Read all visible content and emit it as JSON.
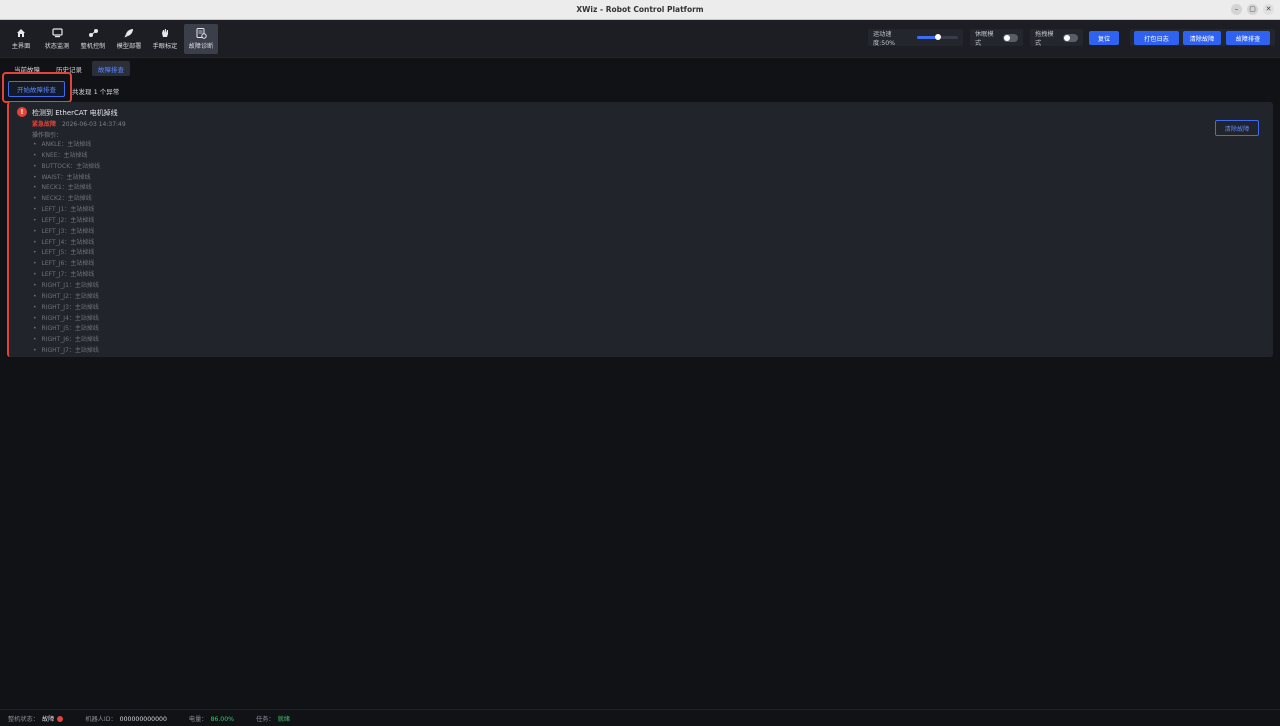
{
  "window": {
    "title": "XWiz - Robot Control Platform"
  },
  "nav": [
    {
      "label": "主界面",
      "icon": "home-icon"
    },
    {
      "label": "状态监测",
      "icon": "monitor-icon"
    },
    {
      "label": "整机控制",
      "icon": "control-icon"
    },
    {
      "label": "模型部署",
      "icon": "rocket-icon"
    },
    {
      "label": "手眼标定",
      "icon": "hand-icon"
    },
    {
      "label": "故障诊断",
      "icon": "diagnosis-icon",
      "active": true
    }
  ],
  "controls": {
    "speed_label": "运动速度:50%",
    "speed_value": 50,
    "rest_mode_label": "休眠模式",
    "drag_mode_label": "拖拽模式",
    "reset_label": "复位",
    "print_log_label": "打包日志",
    "clear_fault_label": "清除故障",
    "fault_check_label": "故障排查"
  },
  "tabs": [
    {
      "label": "当前故障"
    },
    {
      "label": "历史记录"
    },
    {
      "label": "故障排查",
      "active": true
    }
  ],
  "diagnosis": {
    "start_button": "开始故障排查",
    "found_text": "共发现 1 个异常"
  },
  "fault": {
    "icon_text": "!",
    "title": "检测到 EtherCAT 电机掉线",
    "severity": "紧急故障",
    "timestamp": "2026-06-03 14:37:49",
    "guide_label": "操作指引：",
    "items": [
      "ANKLE：主站掉线",
      "KNEE：主站掉线",
      "BUTTOCK：主站掉线",
      "WAIST：主站掉线",
      "NECK1：主站掉线",
      "NECK2：主站掉线",
      "LEFT_J1：主站掉线",
      "LEFT_J2：主站掉线",
      "LEFT_J3：主站掉线",
      "LEFT_J4：主站掉线",
      "LEFT_J5：主站掉线",
      "LEFT_J6：主站掉线",
      "LEFT_J7：主站掉线",
      "RIGHT_J1：主站掉线",
      "RIGHT_J2：主站掉线",
      "RIGHT_J3：主站掉线",
      "RIGHT_J4：主站掉线",
      "RIGHT_J5：主站掉线",
      "RIGHT_J6：主站掉线",
      "RIGHT_J7：主站掉线"
    ],
    "clear_button": "清除故障"
  },
  "status": {
    "machine_state_label": "整机状态：",
    "machine_state_value": "故障",
    "robot_id_label": "机器人ID：",
    "robot_id_value": "000000000000",
    "battery_label": "电量：",
    "battery_value": "86.00%",
    "task_label": "任务：",
    "task_value": "就绪"
  },
  "colors": {
    "accent": "#2f62f1",
    "error": "#e2443a",
    "ok": "#3ec46d",
    "background": "#111216"
  }
}
